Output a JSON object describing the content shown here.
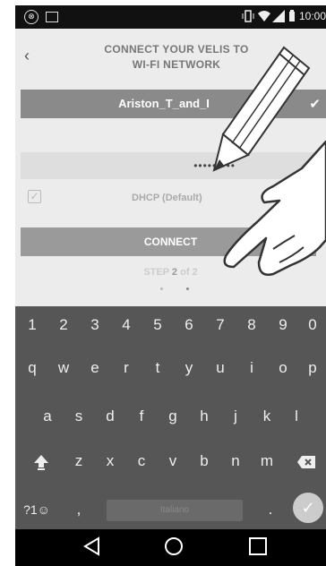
{
  "status_bar": {
    "time": "10:00"
  },
  "header": {
    "back_label": "‹",
    "title_line1": "CONNECT YOUR VELIS TO",
    "title_line2": "WI-FI NETWORK"
  },
  "network": {
    "ssid": "Ariston_T_and_I",
    "password_masked": "•••••••••"
  },
  "dhcp": {
    "label": "DHCP (Default)",
    "checked": true
  },
  "connect_button": {
    "label": "CONNECT"
  },
  "step": {
    "prefix": "STEP",
    "current": "2",
    "of": "of",
    "total": "2"
  },
  "keyboard": {
    "numbers": [
      "1",
      "2",
      "3",
      "4",
      "5",
      "6",
      "7",
      "8",
      "9",
      "0"
    ],
    "row1": [
      "q",
      "w",
      "e",
      "r",
      "t",
      "y",
      "u",
      "i",
      "o",
      "p"
    ],
    "row2": [
      "a",
      "s",
      "d",
      "f",
      "g",
      "h",
      "j",
      "k",
      "l"
    ],
    "row3": [
      "z",
      "x",
      "c",
      "v",
      "b",
      "n",
      "m"
    ],
    "symbols_label": "?1☺",
    "comma": ",",
    "space_label": "Italiano",
    "period": "."
  },
  "icons": {
    "back": "chevron-left-icon",
    "check": "check-icon",
    "shift": "shift-icon",
    "backspace": "backspace-icon",
    "enter": "check-circle-icon"
  },
  "colors": {
    "app_bg": "#ececec",
    "ssid_bar": "#8a8a8a",
    "connect_btn": "#9a9a9a",
    "keyboard_bg": "#565656"
  }
}
